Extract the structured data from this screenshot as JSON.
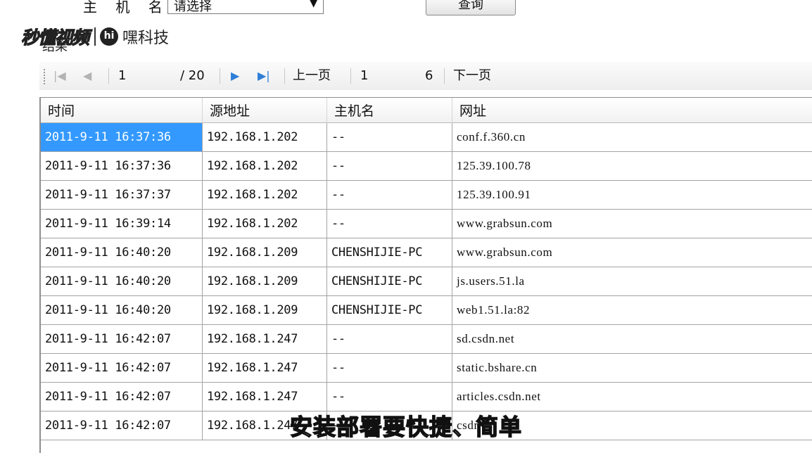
{
  "filter": {
    "host_label": "主 机 名",
    "select_value": "请选择",
    "query_button": "查询"
  },
  "brand": {
    "logo_text": "秒懂视频",
    "hi_text": "hi",
    "name": "嘿科技"
  },
  "results_label": "结果",
  "pager": {
    "current_page": "1",
    "total_pages": "/ 20",
    "prev_label": "上一页",
    "page_input": "1",
    "page_count": "6",
    "next_label": "下一页"
  },
  "table": {
    "columns": [
      "时间",
      "源地址",
      "主机名",
      "网址"
    ],
    "rows": [
      [
        "2011-9-11 16:37:36",
        "192.168.1.202",
        "--",
        "conf.f.360.cn"
      ],
      [
        "2011-9-11 16:37:36",
        "192.168.1.202",
        "--",
        "125.39.100.78"
      ],
      [
        "2011-9-11 16:37:37",
        "192.168.1.202",
        "--",
        "125.39.100.91"
      ],
      [
        "2011-9-11 16:39:14",
        "192.168.1.202",
        "--",
        "www.grabsun.com"
      ],
      [
        "2011-9-11 16:40:20",
        "192.168.1.209",
        "CHENSHIJIE-PC",
        "www.grabsun.com"
      ],
      [
        "2011-9-11 16:40:20",
        "192.168.1.209",
        "CHENSHIJIE-PC",
        "js.users.51.la"
      ],
      [
        "2011-9-11 16:40:20",
        "192.168.1.209",
        "CHENSHIJIE-PC",
        "web1.51.la:82"
      ],
      [
        "2011-9-11 16:42:07",
        "192.168.1.247",
        "--",
        "sd.csdn.net"
      ],
      [
        "2011-9-11 16:42:07",
        "192.168.1.247",
        "--",
        "static.bshare.cn"
      ],
      [
        "2011-9-11 16:42:07",
        "192.168.1.247",
        "--",
        "articles.csdn.net"
      ],
      [
        "2011-9-11 16:42:07",
        "192.168.1.247",
        "--",
        "csdn"
      ]
    ],
    "selected_row": 0
  },
  "subtitle": "安装部署要快捷、简单",
  "colors": {
    "selection": "#3399ff",
    "pager_icon": "#2f7ed8"
  },
  "icons": {
    "first": "first-page-icon",
    "prev": "prev-page-icon",
    "next": "next-page-icon",
    "last": "last-page-icon"
  }
}
